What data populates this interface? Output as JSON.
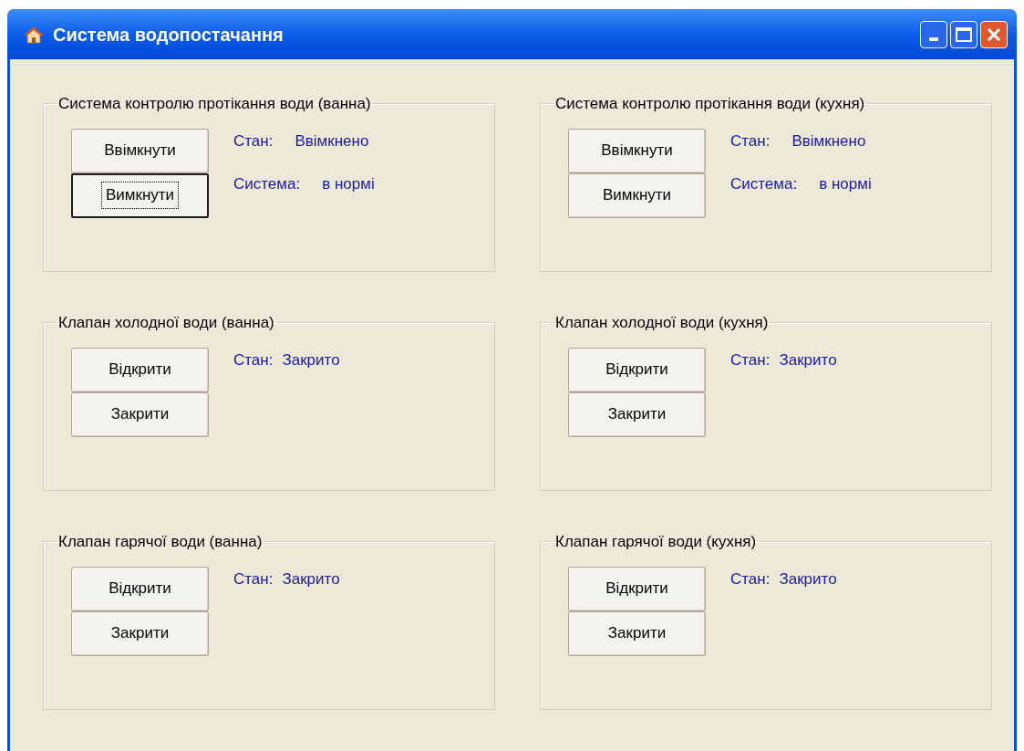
{
  "window": {
    "title": "Система водопостачання"
  },
  "groups": [
    {
      "kind": "system",
      "title": "Система контролю протікання води (ванна)",
      "buttons": [
        {
          "label": "Ввімкнути",
          "focused": false
        },
        {
          "label": "Вимкнути",
          "focused": true
        }
      ],
      "status": [
        {
          "label": "Стан:",
          "value": "Ввімкнено"
        },
        {
          "label": "Система:",
          "value": "в нормі"
        }
      ]
    },
    {
      "kind": "system",
      "title": "Система контролю протікання води (кухня)",
      "buttons": [
        {
          "label": "Ввімкнути",
          "focused": false
        },
        {
          "label": "Вимкнути",
          "focused": false
        }
      ],
      "status": [
        {
          "label": "Стан:",
          "value": "Ввімкнено"
        },
        {
          "label": "Система:",
          "value": "в нормі"
        }
      ]
    },
    {
      "kind": "valve",
      "title": "Клапан холодної води (ванна)",
      "buttons": [
        {
          "label": "Відкрити",
          "focused": false
        },
        {
          "label": "Закрити",
          "focused": false
        }
      ],
      "status": [
        {
          "label": "Стан:",
          "value": "Закрито"
        }
      ]
    },
    {
      "kind": "valve",
      "title": "Клапан холодної води (кухня)",
      "buttons": [
        {
          "label": "Відкрити",
          "focused": false
        },
        {
          "label": "Закрити",
          "focused": false
        }
      ],
      "status": [
        {
          "label": "Стан:",
          "value": "Закрито"
        }
      ]
    },
    {
      "kind": "valve",
      "title": "Клапан гарячої води (ванна)",
      "buttons": [
        {
          "label": "Відкрити",
          "focused": false
        },
        {
          "label": "Закрити",
          "focused": false
        }
      ],
      "status": [
        {
          "label": "Стан:",
          "value": "Закрито"
        }
      ]
    },
    {
      "kind": "valve",
      "title": "Клапан гарячої води (кухня)",
      "buttons": [
        {
          "label": "Відкрити",
          "focused": false
        },
        {
          "label": "Закрити",
          "focused": false
        }
      ],
      "status": [
        {
          "label": "Стан:",
          "value": "Закрито"
        }
      ]
    }
  ]
}
